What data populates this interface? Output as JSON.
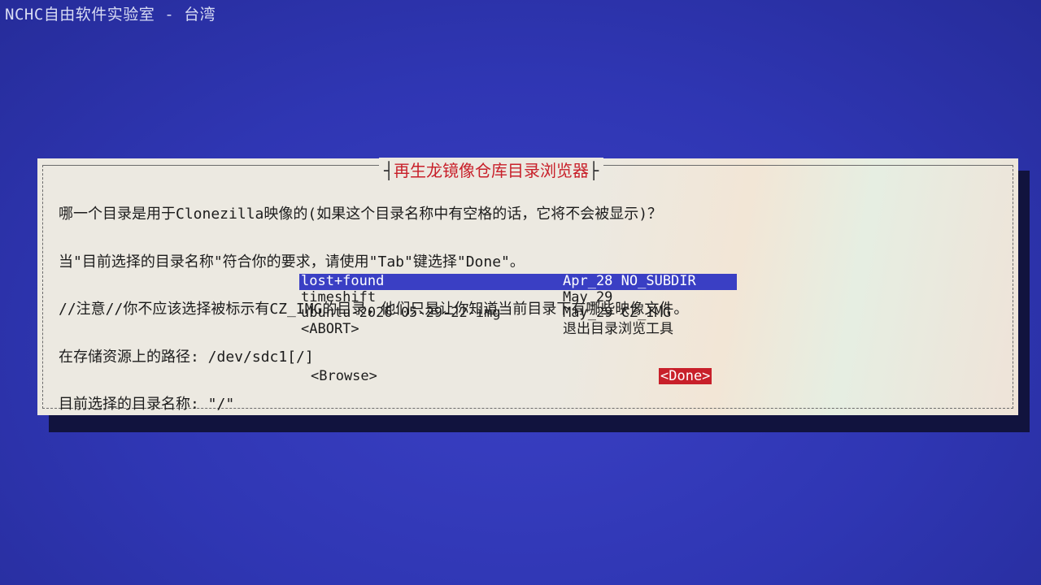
{
  "backtitle": "NCHC自由软件实验室 - 台湾",
  "dialog": {
    "title": "再生龙镜像仓库目录浏览器",
    "title_left_bracket": "┤",
    "title_right_bracket": "├",
    "message_lines": [
      "哪一个目录是用于Clonezilla映像的(如果这个目录名称中有空格的话，它将不会被显示)？",
      "当\"目前选择的目录名称\"符合你的要求，请使用\"Tab\"键选择\"Done\"。",
      "//注意//你不应该选择被标示有CZ_IMG的目录，他们只是让你知道当前目录下有哪些映像文件。",
      "在存储资源上的路径: /dev/sdc1[/]",
      "目前选择的目录名称: \"/\""
    ],
    "items": [
      {
        "name": "lost+found",
        "info": "Apr_28 NO_SUBDIR",
        "selected": true
      },
      {
        "name": "timeshift",
        "info": "May_29",
        "selected": false
      },
      {
        "name": "ubuntu-2026-05-29-22-img",
        "info": "May_29 CZ_IMG",
        "selected": false
      },
      {
        "name": "<ABORT>",
        "info": "退出目录浏览工具",
        "selected": false
      }
    ],
    "buttons": {
      "browse": "<Browse>",
      "done": "<Done>"
    }
  },
  "colors": {
    "background": "#2f36b3",
    "dialog_bg": "#ece9e1",
    "title": "#c8202a",
    "selection": "#3a3fc4",
    "done_button": "#c8202a"
  }
}
